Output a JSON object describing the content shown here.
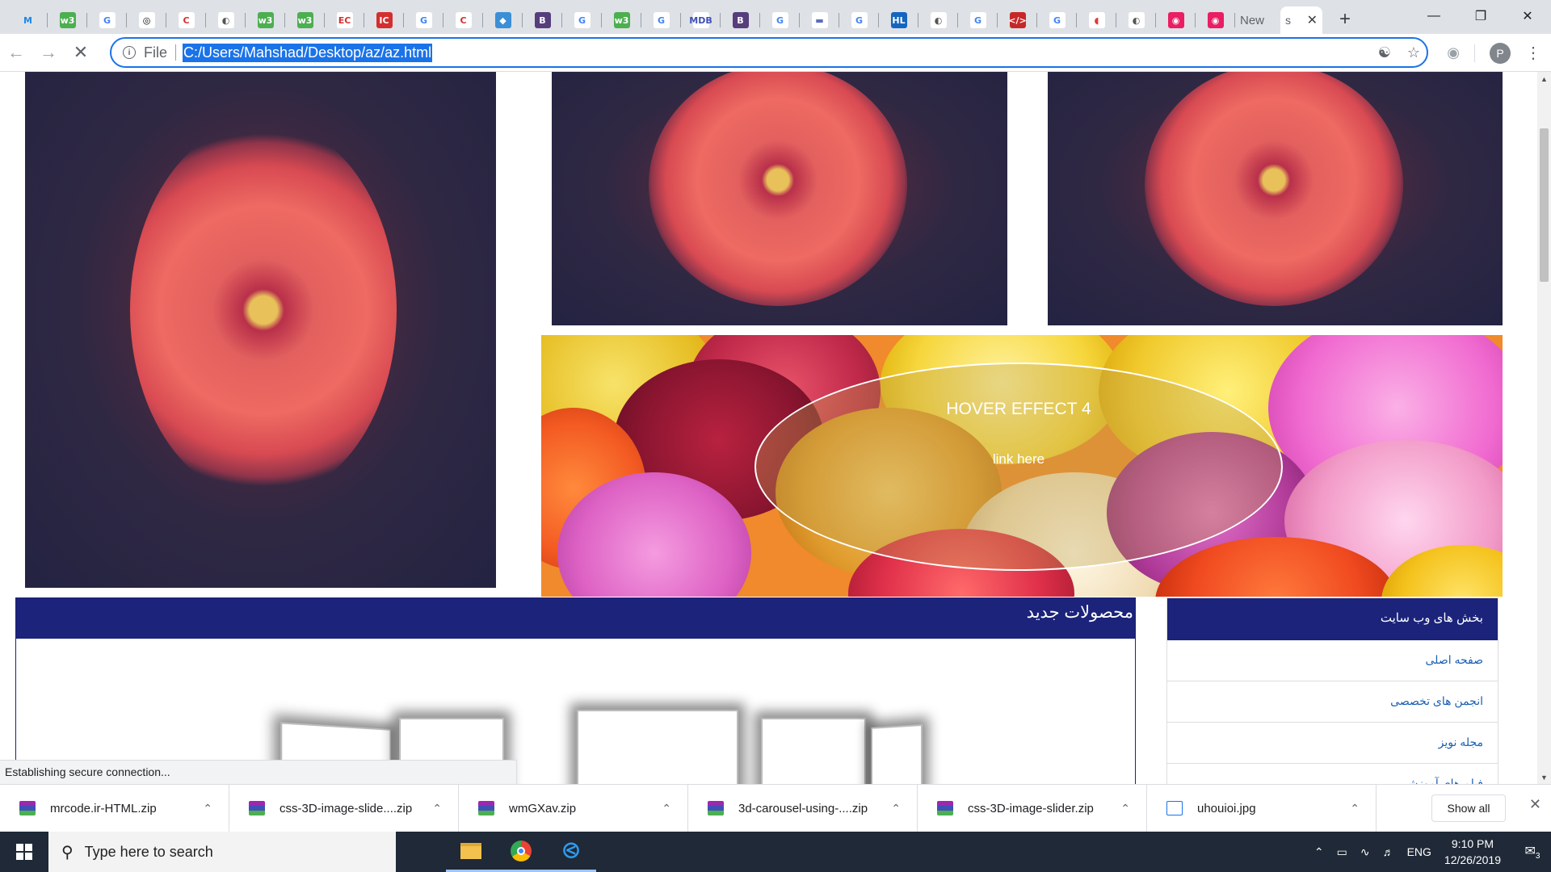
{
  "browser": {
    "tab_icons": [
      {
        "icon": "M",
        "color": "#1e88e5",
        "text_color": "#1e88e5",
        "bg": "transparent"
      },
      {
        "icon": "w3",
        "color": "#4caf50"
      },
      {
        "icon": "G",
        "color": "#fff",
        "text_color": "#4285f4"
      },
      {
        "icon": "◎",
        "color": "#fff",
        "text_color": "#000"
      },
      {
        "icon": "C",
        "color": "#fff",
        "text_color": "#d32f2f"
      },
      {
        "icon": "◐",
        "color": "#fff",
        "text_color": "#555"
      },
      {
        "icon": "w3",
        "color": "#4caf50"
      },
      {
        "icon": "w3",
        "color": "#4caf50"
      },
      {
        "icon": "EC",
        "color": "#fff",
        "text_color": "#d32f2f"
      },
      {
        "icon": "IC",
        "color": "#d32f2f"
      },
      {
        "icon": "G",
        "color": "#fff",
        "text_color": "#4285f4"
      },
      {
        "icon": "C",
        "color": "#fff",
        "text_color": "#d32f2f"
      },
      {
        "icon": "◆",
        "color": "#3b8fd6"
      },
      {
        "icon": "B",
        "color": "#563d7c"
      },
      {
        "icon": "G",
        "color": "#fff",
        "text_color": "#4285f4"
      },
      {
        "icon": "w3",
        "color": "#4caf50"
      },
      {
        "icon": "G",
        "color": "#fff",
        "text_color": "#4285f4"
      },
      {
        "icon": "MDB",
        "color": "#fff",
        "text_color": "#3f51b5"
      },
      {
        "icon": "B",
        "color": "#563d7c"
      },
      {
        "icon": "G",
        "color": "#fff",
        "text_color": "#4285f4"
      },
      {
        "icon": "▬",
        "color": "#fff",
        "text_color": "#5c6bc0"
      },
      {
        "icon": "G",
        "color": "#fff",
        "text_color": "#4285f4"
      },
      {
        "icon": "HL",
        "color": "#1565c0"
      },
      {
        "icon": "◐",
        "color": "#fff",
        "text_color": "#555"
      },
      {
        "icon": "G",
        "color": "#fff",
        "text_color": "#4285f4"
      },
      {
        "icon": "</>",
        "color": "#c62828"
      },
      {
        "icon": "G",
        "color": "#fff",
        "text_color": "#4285f4"
      },
      {
        "icon": "◖",
        "color": "#fff",
        "text_color": "#e53935"
      },
      {
        "icon": "◐",
        "color": "#fff",
        "text_color": "#555"
      },
      {
        "icon": "◉",
        "color": "#e91e63"
      },
      {
        "icon": "◉",
        "color": "#e91e63"
      }
    ],
    "new_tab_label": "New",
    "active_tab_title": "s",
    "address": {
      "scheme_label": "File",
      "url": "C:/Users/Mahshad/Desktop/az/az.html"
    },
    "profile_initial": "P"
  },
  "page": {
    "hover": {
      "title": "HOVER EFFECT 4",
      "link": "link here"
    },
    "products": {
      "header": "محصولات جدید"
    },
    "sidebar": {
      "header": "بخش های وب سایت",
      "items": [
        {
          "label": "صفحه اصلی"
        },
        {
          "label": "انجمن های تخصصی"
        },
        {
          "label": "مجله نویز"
        },
        {
          "label": "فیلم های آموزشی"
        }
      ]
    },
    "status": "Establishing secure connection..."
  },
  "downloads": {
    "items": [
      {
        "name": "mrcode.ir-HTML.zip",
        "type": "zip"
      },
      {
        "name": "css-3D-image-slide....zip",
        "type": "zip"
      },
      {
        "name": "wmGXav.zip",
        "type": "zip"
      },
      {
        "name": "3d-carousel-using-....zip",
        "type": "zip"
      },
      {
        "name": "css-3D-image-slider.zip",
        "type": "zip"
      },
      {
        "name": "uhouioi.jpg",
        "type": "jpg"
      }
    ],
    "show_all": "Show all"
  },
  "taskbar": {
    "search_placeholder": "Type here to search",
    "language": "ENG",
    "time": "9:10 PM",
    "date": "12/26/2019",
    "notification_count": "3"
  }
}
